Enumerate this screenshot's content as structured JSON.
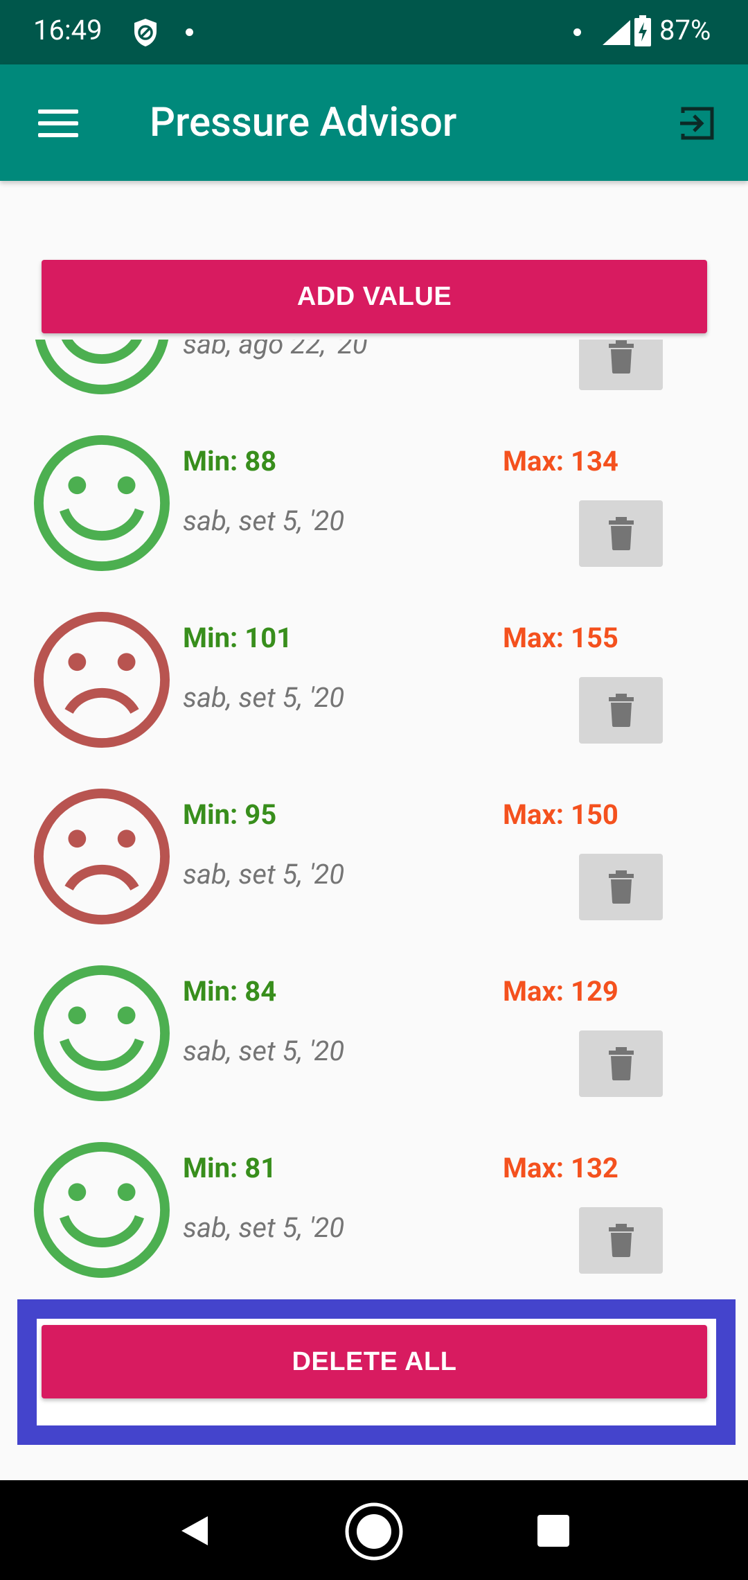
{
  "status_bar": {
    "time": "16:49",
    "battery": "87%"
  },
  "app_bar": {
    "title": "Pressure Advisor"
  },
  "add_button": "ADD VALUE",
  "delete_button": "DELETE ALL",
  "entries": [
    {
      "min": "",
      "max": "",
      "date": "sab, ago 22, '20",
      "mood": "happy"
    },
    {
      "min": "Min: 88",
      "max": "Max: 134",
      "date": "sab, set 5, '20",
      "mood": "happy"
    },
    {
      "min": "Min: 101",
      "max": "Max: 155",
      "date": "sab, set 5, '20",
      "mood": "sad"
    },
    {
      "min": "Min: 95",
      "max": "Max: 150",
      "date": "sab, set 5, '20",
      "mood": "sad"
    },
    {
      "min": "Min: 84",
      "max": "Max: 129",
      "date": "sab, set 5, '20",
      "mood": "happy"
    },
    {
      "min": "Min: 81",
      "max": "Max: 132",
      "date": "sab, set 5, '20",
      "mood": "happy"
    }
  ],
  "colors": {
    "status_bar": "#00574b",
    "app_bar": "#00897b",
    "accent": "#d81b60",
    "happy": "#4caf50",
    "sad": "#b85450",
    "min_text": "#388e1c",
    "max_text": "#f4511e",
    "highlight": "#4444cc"
  }
}
